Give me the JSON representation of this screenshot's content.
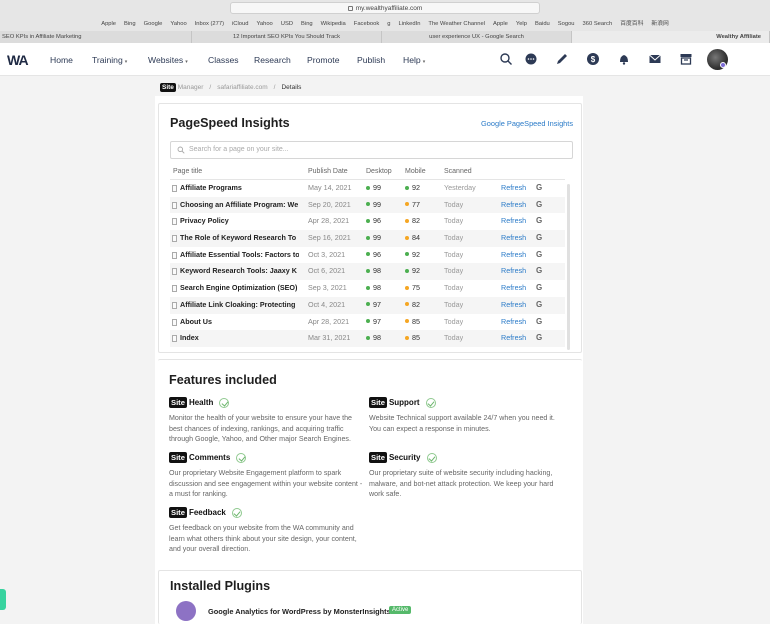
{
  "browser": {
    "url": "my.wealthyaffiliate.com",
    "bookmarks": [
      "Apple",
      "Bing",
      "Google",
      "Yahoo",
      "Inbox (277)",
      "iCloud",
      "Yahoo",
      "USD",
      "Bing",
      "Wikipedia",
      "Facebook",
      "g",
      "LinkedIn",
      "The Weather Channel",
      "Apple",
      "Yelp",
      "Baidu",
      "Sogou",
      "360 Search",
      "百度百科",
      "新浪网"
    ],
    "tabs": [
      "SEO KPIs in Affiliate Marketing",
      "12 Important SEO KPIs You Should Track",
      "user experience UX - Google Search",
      "Wealthy Affiliate"
    ]
  },
  "nav": {
    "logo": "WA",
    "items": [
      {
        "label": "Home"
      },
      {
        "label": "Training",
        "chevron": true
      },
      {
        "label": "Websites",
        "chevron": true
      },
      {
        "label": "Classes"
      },
      {
        "label": "Research"
      },
      {
        "label": "Promote"
      },
      {
        "label": "Publish"
      },
      {
        "label": "Help",
        "chevron": true
      }
    ],
    "icons": [
      "search-icon",
      "chat-icon",
      "pencil-icon",
      "dollar-icon",
      "bell-icon",
      "mail-icon",
      "archive-icon"
    ]
  },
  "breadcrumb": {
    "badge": "Site",
    "manager": "Manager",
    "site": "safariaffiliate.com",
    "current": "Details"
  },
  "pagespeed": {
    "title": "PageSpeed Insights",
    "link": "Google PageSpeed Insights",
    "search_placeholder": "Search for a page on your site...",
    "columns": [
      "Page title",
      "Publish Date",
      "Desktop",
      "Mobile",
      "Scanned"
    ],
    "refresh_label": "Refresh",
    "google_label": "G",
    "rows": [
      {
        "title": "Affiliate Programs",
        "date": "May 14, 2021",
        "desktop": "99",
        "mobile": "92",
        "scanned": "Yesterday"
      },
      {
        "title": "Choosing an Affiliate Program: We",
        "date": "Sep 20, 2021",
        "desktop": "99",
        "mobile": "77",
        "scanned": "Today"
      },
      {
        "title": "Privacy Policy",
        "date": "Apr 28, 2021",
        "desktop": "96",
        "mobile": "82",
        "scanned": "Today"
      },
      {
        "title": "The Role of Keyword Research To",
        "date": "Sep 16, 2021",
        "desktop": "99",
        "mobile": "84",
        "scanned": "Today"
      },
      {
        "title": "Affiliate Essential Tools: Factors to",
        "date": "Oct 3, 2021",
        "desktop": "96",
        "mobile": "92",
        "scanned": "Today"
      },
      {
        "title": "Keyword Research Tools: Jaaxy K",
        "date": "Oct 6, 2021",
        "desktop": "98",
        "mobile": "92",
        "scanned": "Today"
      },
      {
        "title": "Search Engine Optimization (SEO)",
        "date": "Sep 3, 2021",
        "desktop": "98",
        "mobile": "75",
        "scanned": "Today"
      },
      {
        "title": "Affiliate Link Cloaking: Protecting",
        "date": "Oct 4, 2021",
        "desktop": "97",
        "mobile": "82",
        "scanned": "Today"
      },
      {
        "title": "About Us",
        "date": "Apr 28, 2021",
        "desktop": "97",
        "mobile": "85",
        "scanned": "Today"
      },
      {
        "title": "Index",
        "date": "Mar 31, 2021",
        "desktop": "98",
        "mobile": "85",
        "scanned": "Today"
      }
    ]
  },
  "features": {
    "title": "Features included",
    "badge": "Site",
    "items": [
      {
        "name": "Health",
        "desc": "Monitor the health of your website to ensure your have the best chances of indexing, rankings, and acquiring traffic through Google, Yahoo, and Other major Search Engines."
      },
      {
        "name": "Support",
        "desc": "Website Technical support available 24/7 when you need it. You can expect a response in minutes."
      },
      {
        "name": "Comments",
        "desc": "Our proprietary Website Engagement platform to spark discussion and see engagement within your website content - a must for ranking."
      },
      {
        "name": "Security",
        "desc": "Our proprietary suite of website security including hacking, malware, and bot-net attack protection. We keep your hard work safe."
      },
      {
        "name": "Feedback",
        "desc": "Get feedback on your website from the WA community and learn what others think about your site design, your content, and your overall direction."
      }
    ]
  },
  "plugins": {
    "title": "Installed Plugins",
    "items": [
      {
        "name": "Google Analytics for WordPress by MonsterInsights",
        "status": "Active"
      }
    ]
  },
  "colors": {
    "link": "#2b7bc8",
    "score_good": "#4caf50",
    "score_ok": "#f5a623",
    "active": "#55b96a"
  }
}
